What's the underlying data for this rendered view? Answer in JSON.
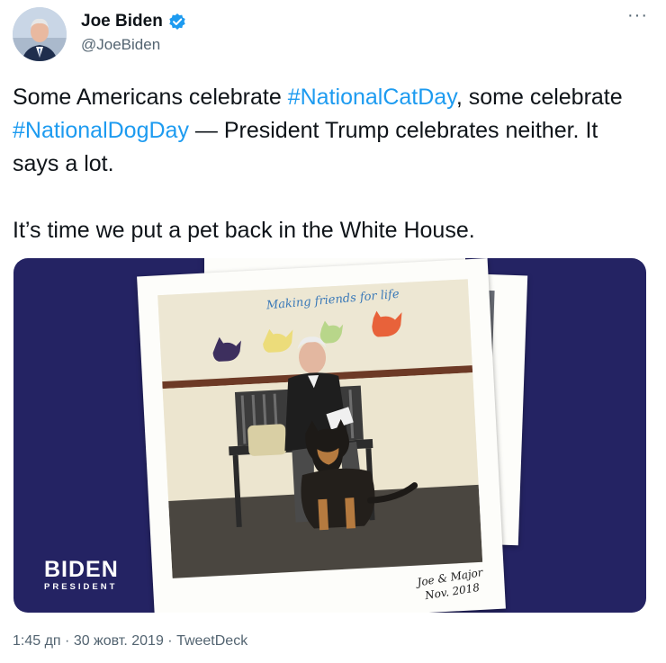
{
  "author": {
    "display_name": "Joe Biden",
    "handle": "@JoeBiden",
    "verified": true,
    "avatar_icon": "avatar"
  },
  "more_menu": {
    "label": "···"
  },
  "tweet": {
    "line1_pre": "Some Americans celebrate ",
    "hashtag1": "#NationalCatDay",
    "line1_post": ", some celebrate ",
    "hashtag2": "#NationalDogDay",
    "line2_post": " — President Trump celebrates neither. It says a lot.",
    "paragraph2": "It’s time we put a pet back in the White House."
  },
  "media": {
    "photo_caption_top": "Making friends for life",
    "caption_line1": "Joe & Major",
    "caption_line2": "Nov. 2018",
    "logo_text": "BIDEN",
    "logo_sub": "PRESIDENT",
    "background_color": "#242363"
  },
  "footer": {
    "time": "1:45 дп",
    "separator1": " · ",
    "date": "30 жовт. 2019",
    "separator2": " · ",
    "source": "TweetDeck"
  },
  "colors": {
    "link": "#1d9bf0",
    "secondary_text": "#536471",
    "primary_text": "#0f1419"
  }
}
